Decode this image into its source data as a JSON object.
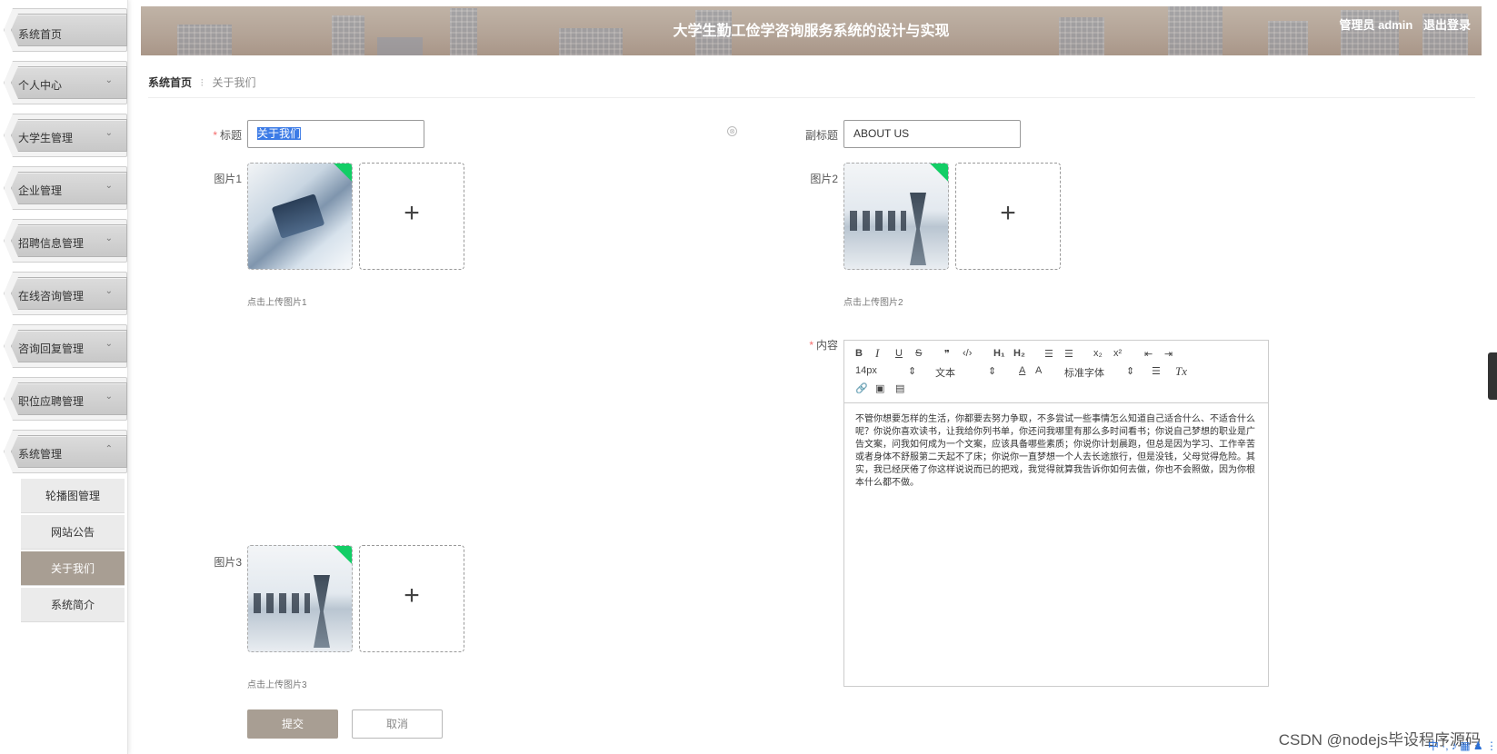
{
  "sidebar": {
    "items": [
      {
        "label": "系统首页",
        "chevron": ""
      },
      {
        "label": "个人中心",
        "chevron": "⌄"
      },
      {
        "label": "大学生管理",
        "chevron": "⌄"
      },
      {
        "label": "企业管理",
        "chevron": "⌄"
      },
      {
        "label": "招聘信息管理",
        "chevron": "⌄"
      },
      {
        "label": "在线咨询管理",
        "chevron": "⌄"
      },
      {
        "label": "咨询回复管理",
        "chevron": "⌄"
      },
      {
        "label": "职位应聘管理",
        "chevron": "⌄"
      },
      {
        "label": "系统管理",
        "chevron": "⌃"
      }
    ],
    "sub_items": [
      {
        "label": "轮播图管理"
      },
      {
        "label": "网站公告"
      },
      {
        "label": "关于我们"
      },
      {
        "label": "系统简介"
      }
    ],
    "active_sub": "关于我们"
  },
  "header": {
    "title": "大学生勤工俭学咨询服务系统的设计与实现",
    "role": "管理员 admin",
    "logout": "退出登录"
  },
  "breadcrumb": {
    "home": "系统首页",
    "separator": "⁝",
    "current": "关于我们"
  },
  "form": {
    "title_label": "标题",
    "title_value": "关于我们",
    "subtitle_label": "副标题",
    "subtitle_value": "ABOUT US",
    "image1_label": "图片1",
    "image1_hint": "点击上传图片1",
    "image2_label": "图片2",
    "image2_hint": "点击上传图片2",
    "image3_label": "图片3",
    "image3_hint": "点击上传图片3",
    "content_label": "内容",
    "upload_plus": "+",
    "clear_icon": "⊗"
  },
  "editor": {
    "toolbar": {
      "bold": "B",
      "italic": "I",
      "underline": "U",
      "strike": "S",
      "quote": "❞",
      "code": "‹/›",
      "h1": "H₁",
      "h2": "H₂",
      "ol": "☰",
      "ul": "☰",
      "sub": "x₂",
      "sup": "x²",
      "outdent": "⇤",
      "indent": "⇥",
      "size": "14px",
      "block": "文本",
      "font": "标准字体",
      "color": "A",
      "bg": "A",
      "align": "☰",
      "clean": "Tx",
      "link": "🔗",
      "image": "▣",
      "video": "▤"
    },
    "content": "不管你想要怎样的生活，你都要去努力争取，不多尝试一些事情怎么知道自己适合什么、不适合什么呢？你说你喜欢读书，让我给你列书单，你还问我哪里有那么多时间看书；你说自己梦想的职业是广告文案，问我如何成为一个文案，应该具备哪些素质；你说你计划晨跑，但总是因为学习、工作辛苦或者身体不舒服第二天起不了床；你说你一直梦想一个人去长途旅行，但是没钱，父母觉得危险。其实，我已经厌倦了你这样说说而已的把戏，我觉得就算我告诉你如何去做，你也不会照做，因为你根本什么都不做。"
  },
  "buttons": {
    "submit": "提交",
    "cancel": "取消"
  },
  "watermark": "CSDN @nodejs毕设程序源码",
  "ime": "中 ·, ♪ ▦ ♟ ⋮",
  "colors": {
    "accent": "#a89e93",
    "required": "#f56c6c",
    "selection": "#3c7be6",
    "upload_success": "#13ce66"
  }
}
